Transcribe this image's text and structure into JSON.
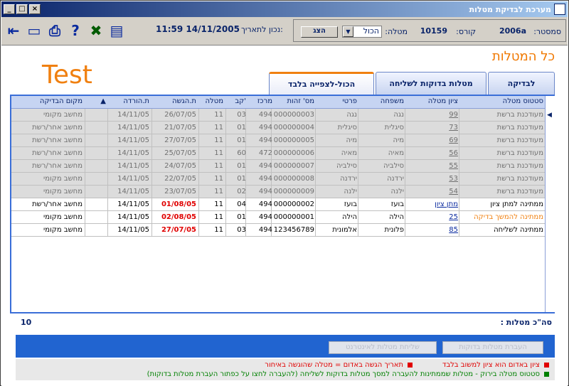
{
  "window": {
    "title": "מערכת לבדיקת מטלות"
  },
  "info": {
    "semester_label": "סמסטר:",
    "semester_value": "2006a",
    "course_label": "קורס:",
    "course_value": "10159",
    "task_label": "מטלה:",
    "task_value": "הכול",
    "show_button": "הצג",
    "date_label": "נכון לתאריך:",
    "date_value": "11:59 14/11/2005"
  },
  "page": {
    "title": "כל המטלות",
    "test_text": "Test"
  },
  "tabs": [
    "לבדיקה",
    "מטלות בדוקות לשליחה",
    "הכול-לצפייה בלבד"
  ],
  "table": {
    "headers": [
      "סטטוס מטלה",
      "ציון מטלה",
      "משפחה",
      "פרטי",
      "מס' זהות",
      "מרכז",
      "קב'",
      "מטלה",
      "ת.הגשה",
      "ת.הורדה",
      "מקום הבדיקה"
    ],
    "rows": [
      {
        "status": "מעודכנת ברשת",
        "grade": "99",
        "family": "נגה",
        "first": "נגה",
        "id": "000000003",
        "center": "494",
        "group": "03",
        "task": "11",
        "submitted": "26/07/05",
        "downloaded": "14/11/05",
        "place": "מחשב מקומי",
        "gray": true
      },
      {
        "status": "מעודכנת ברשת",
        "grade": "73",
        "family": "סיגלית",
        "first": "סיגלית",
        "id": "000000004",
        "center": "494",
        "group": "01",
        "task": "11",
        "submitted": "21/07/05",
        "downloaded": "14/11/05",
        "place": "מחשב אחר/רשת",
        "gray": true
      },
      {
        "status": "מעודכנת ברשת",
        "grade": "69",
        "family": "מיה",
        "first": "מיה",
        "id": "000000005",
        "center": "494",
        "group": "01",
        "task": "11",
        "submitted": "27/07/05",
        "downloaded": "14/11/05",
        "place": "מחשב אחר/רשת",
        "gray": true
      },
      {
        "status": "מעודכנת ברשת",
        "grade": "56",
        "family": "מאיה",
        "first": "מאיה",
        "id": "000000006",
        "center": "472",
        "group": "60",
        "task": "11",
        "submitted": "25/07/05",
        "downloaded": "14/11/05",
        "place": "מחשב אחר/רשת",
        "gray": true
      },
      {
        "status": "מעודכנת ברשת",
        "grade": "55",
        "family": "סילביה",
        "first": "סילביה",
        "id": "000000007",
        "center": "494",
        "group": "01",
        "task": "11",
        "submitted": "24/07/05",
        "downloaded": "14/11/05",
        "place": "מחשב אחר/רשת",
        "gray": true
      },
      {
        "status": "מעודכנת ברשת",
        "grade": "53",
        "family": "ירדנה",
        "first": "ירדנה",
        "id": "000000008",
        "center": "494",
        "group": "01",
        "task": "11",
        "submitted": "22/07/05",
        "downloaded": "14/11/05",
        "place": "מחשב מקומי",
        "gray": true
      },
      {
        "status": "מעודכנת ברשת",
        "grade": "54",
        "family": "ילנה",
        "first": "ילנה",
        "id": "000000009",
        "center": "494",
        "group": "02",
        "task": "11",
        "submitted": "23/07/05",
        "downloaded": "14/11/05",
        "place": "מחשב מקומי",
        "gray": true
      },
      {
        "status": "ממתינה למתן ציון",
        "grade": "מתן ציון",
        "family": "בועז",
        "first": "בועז",
        "id": "000000002",
        "center": "494",
        "group": "04",
        "task": "11",
        "submitted": "01/08/05",
        "downloaded": "14/11/05",
        "place": "מחשב אחר/רשת",
        "gray": false,
        "sub_red": true
      },
      {
        "status": "ממתינה להמשך בדיקה",
        "grade": "25",
        "family": "הילה",
        "first": "הילה",
        "id": "000000001",
        "center": "494",
        "group": "01",
        "task": "11",
        "submitted": "02/08/05",
        "downloaded": "14/11/05",
        "place": "מחשב מקומי",
        "gray": false,
        "sub_red": true,
        "status_orange": true
      },
      {
        "status": "ממתינה לשליחה",
        "grade": "85",
        "family": "פלונית",
        "first": "אלמונית",
        "id": "123456789",
        "center": "494",
        "group": "03",
        "task": "11",
        "submitted": "27/07/05",
        "downloaded": "14/11/05",
        "place": "מחשב מקומי",
        "gray": false,
        "sub_red": true
      }
    ]
  },
  "total": {
    "label": "סה\"כ מטלות :",
    "value": "10"
  },
  "buttons": {
    "transfer": "העברת מטלות בדוקות",
    "send": "שליחת מטלות לאינטרנט"
  },
  "notes": [
    {
      "text": "ציון באדום הוא ציון למשוב בלבד",
      "color": "#e00000"
    },
    {
      "text": "תאריך הגשה באדום = מטלה שהוגשה באיחור",
      "color": "#e00000"
    },
    {
      "text": "סטטוס מטלה בירוק - מטלות שממתינות להעברה למסך מטלות בדוקות לשליחה (להעברה לחצו על כפתור העברת מטלות בדוקות)",
      "color": "#008000"
    }
  ]
}
